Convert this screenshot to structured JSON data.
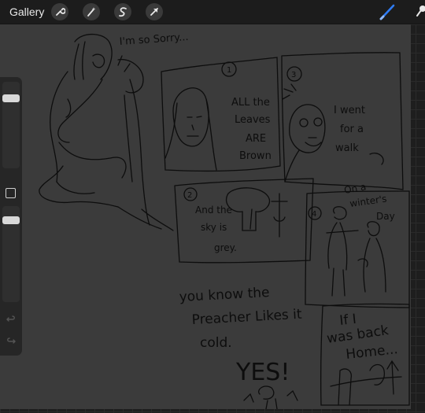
{
  "topbar": {
    "gallery_label": "Gallery",
    "tools": [
      "wrench-icon",
      "magic-wand-icon",
      "selection-icon",
      "transform-arrow-icon"
    ],
    "right_tools": [
      "brush-icon",
      "smudge-icon"
    ],
    "accent_color": "#2f7cf6"
  },
  "sidebar": {
    "brush_size": 0.92,
    "opacity": 0.9
  },
  "canvas": {
    "sketch_text": {
      "sorry": "I'm so Sorry...",
      "panel1_num": "1",
      "panel2_num": "2",
      "panel3_num": "3",
      "panel4_num": "4",
      "leaves_1": "ALL the",
      "leaves_2": "Leaves",
      "leaves_3": "ARE",
      "leaves_4": "Brown",
      "walk_1": "I went",
      "walk_2": "for a",
      "walk_3": "walk",
      "sky_1": "And the",
      "sky_2": "sky is",
      "sky_3": "grey.",
      "winter_1": "On a",
      "winter_2": "winter's",
      "winter_3": "Day",
      "preacher_1": "you know the",
      "preacher_2": "Preacher Likes it",
      "preacher_3": "cold.",
      "back_1": "If I",
      "back_2": "was back",
      "back_3": "Home...",
      "yes": "YES!"
    }
  }
}
